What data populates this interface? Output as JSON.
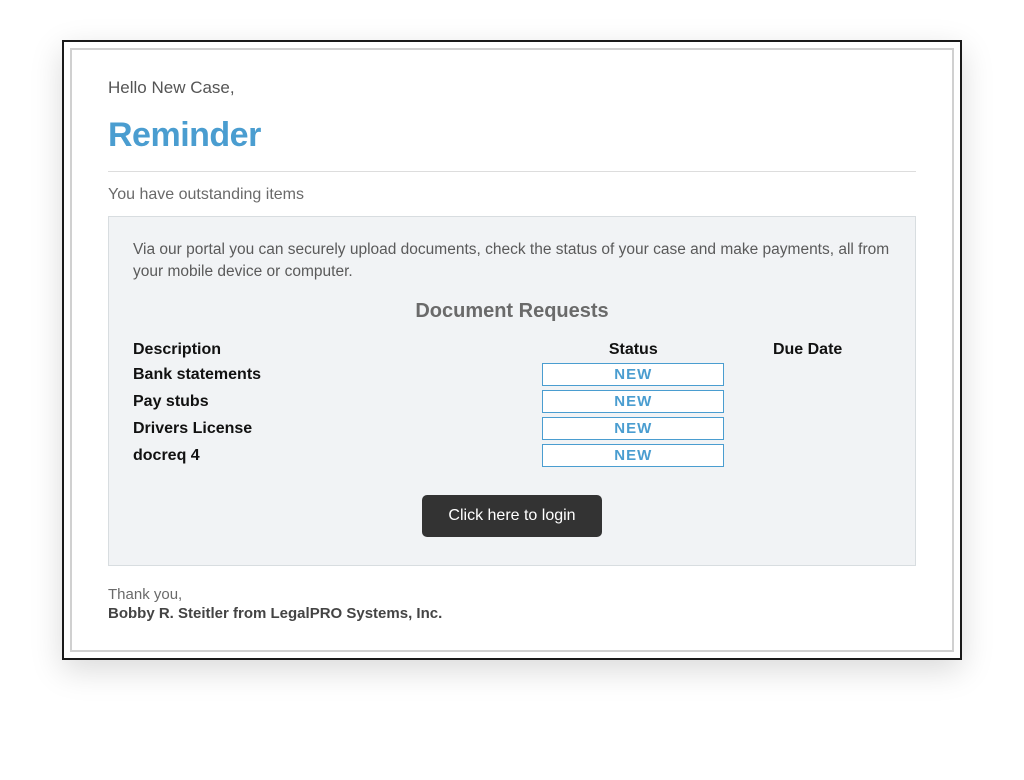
{
  "greeting": "Hello New Case,",
  "title": "Reminder",
  "subtitle": "You have outstanding items",
  "panel": {
    "intro": "Via our portal you can securely upload documents, check the status of your case and make payments, all from your mobile device or computer.",
    "heading": "Document Requests",
    "columns": {
      "description": "Description",
      "status": "Status",
      "due_date": "Due Date"
    },
    "rows": [
      {
        "description": "Bank statements",
        "status": "NEW",
        "due_date": ""
      },
      {
        "description": "Pay stubs",
        "status": "NEW",
        "due_date": ""
      },
      {
        "description": "Drivers License",
        "status": "NEW",
        "due_date": ""
      },
      {
        "description": "docreq 4",
        "status": "NEW",
        "due_date": ""
      }
    ],
    "login_button": "Click here to login"
  },
  "closing": {
    "thankyou": "Thank you,",
    "signature": "Bobby R. Steitler from LegalPRO Systems, Inc."
  }
}
